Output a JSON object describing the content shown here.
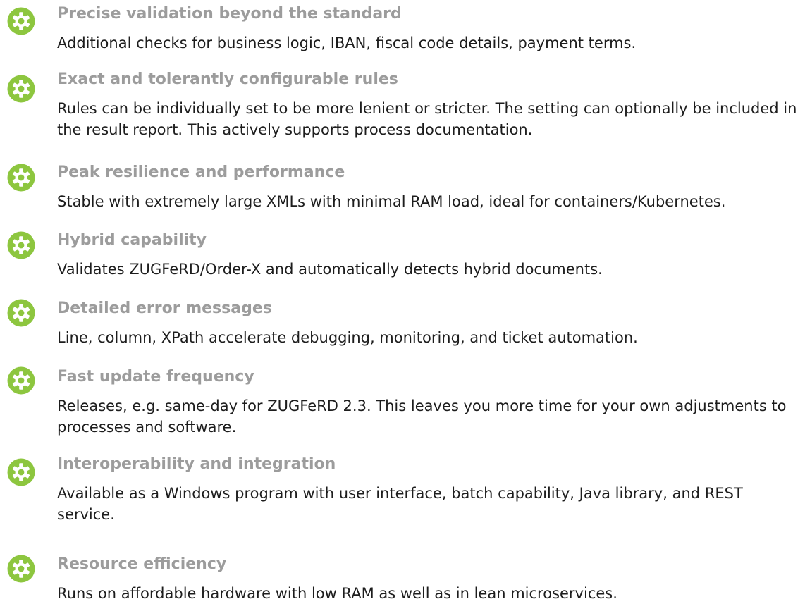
{
  "accent_color": "#8dc63f",
  "features": [
    {
      "icon": "gear-icon",
      "title": "Precise validation beyond the standard",
      "description": "Additional checks for business logic, IBAN, fiscal code details, payment terms."
    },
    {
      "icon": "gear-icon",
      "title": "Exact and tolerantly configurable rules",
      "description": "Rules can be individually set to be more lenient or stricter. The setting can optionally be included in the result report. This actively supports process documentation."
    },
    {
      "icon": "gear-icon",
      "title": "Peak resilience and performance",
      "description": "Stable with extremely large XMLs with minimal RAM load, ideal for containers/Kubernetes."
    },
    {
      "icon": "gear-icon",
      "title": "Hybrid capability",
      "description": "Validates ZUGFeRD/Order-X and automatically detects hybrid documents."
    },
    {
      "icon": "gear-icon",
      "title": "Detailed error messages",
      "description": "Line, column, XPath accelerate debugging, monitoring, and ticket automation."
    },
    {
      "icon": "gear-icon",
      "title": "Fast update frequency",
      "description": "Releases, e.g. same-day for ZUGFeRD 2.3. This leaves you more time for your own adjustments to processes and software."
    },
    {
      "icon": "gear-icon",
      "title": "Interoperability and integration",
      "description": "Available as a Windows program with user interface, batch capability, Java library, and REST service."
    },
    {
      "icon": "gear-icon",
      "title": "Resource efficiency",
      "description": "Runs on affordable hardware with low RAM as well as in lean microservices."
    }
  ]
}
